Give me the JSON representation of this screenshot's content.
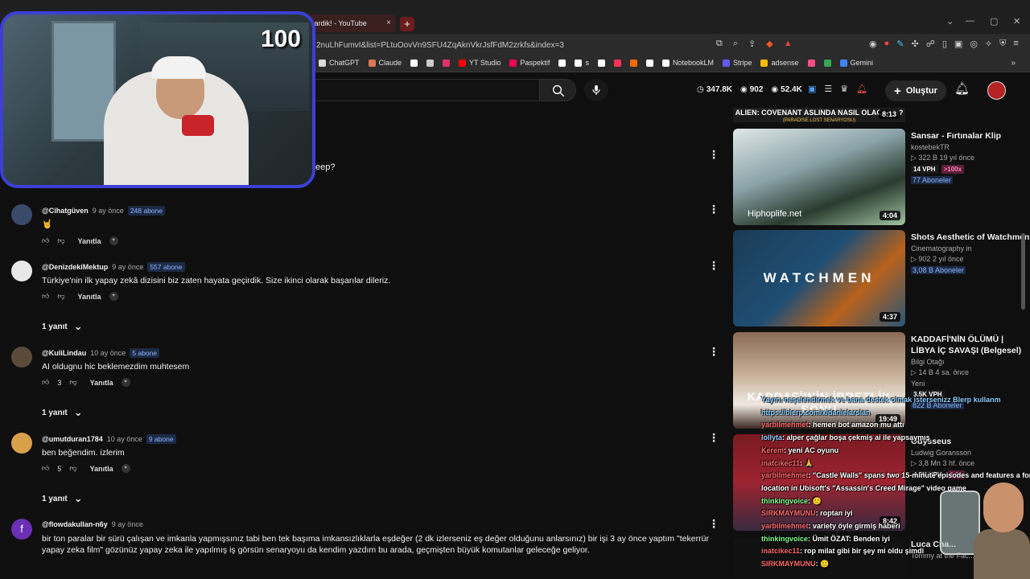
{
  "browser": {
    "tab_title": "tardik! - YouTube",
    "new_tab": "+",
    "tab_close": "×",
    "window": {
      "minimize": "—",
      "maximize": "▢",
      "close": "✕"
    },
    "url": "2nuLhFumvI&list=PLtuOovVn9SFU4ZqAknVkrJsfFdM2zrkfs&index=3",
    "bookmarks": [
      {
        "label": "ChatGPT",
        "color": "#d9d9d9"
      },
      {
        "label": "Claude",
        "color": "#d97757"
      },
      {
        "label": "",
        "color": "#ffffff"
      },
      {
        "label": "",
        "color": "#cccccc"
      },
      {
        "label": "",
        "color": "#e1306c"
      },
      {
        "label": "YT Studio",
        "color": "#ff0000"
      },
      {
        "label": "Paspektif",
        "color": "#ff0055"
      },
      {
        "label": "",
        "color": "#ffffff"
      },
      {
        "label": "s",
        "color": "#ffffff"
      },
      {
        "label": "",
        "color": "#ffffff"
      },
      {
        "label": "",
        "color": "#ff3355"
      },
      {
        "label": "",
        "color": "#ff6a00"
      },
      {
        "label": "",
        "color": "#ffffff"
      },
      {
        "label": "NotebookLM",
        "color": "#ffffff"
      },
      {
        "label": "Stripe",
        "color": "#635bff"
      },
      {
        "label": "adsense",
        "color": "#fbbc04"
      },
      {
        "label": "",
        "color": "#ff4d8a"
      },
      {
        "label": "",
        "color": "#34a853"
      },
      {
        "label": "Gemini",
        "color": "#4285f4"
      }
    ],
    "bookmarks_more": "»"
  },
  "header": {
    "stats": [
      {
        "icon": "clock-icon",
        "value": "347.8K"
      },
      {
        "icon": "eye-icon",
        "value": "902"
      },
      {
        "icon": "eye-icon",
        "value": "52.4K"
      }
    ],
    "create_label": "Oluştur"
  },
  "webcam": {
    "counter": "100"
  },
  "comments": {
    "partial_text": "eep?",
    "items": [
      {
        "user": "@Cihatgüven",
        "time": "9 ay önce",
        "subs": "248 abone",
        "text": "🤘",
        "likes": "",
        "reply": "Yanıtla",
        "avatar": "#3b4a6b"
      },
      {
        "user": "@DenizdekiMektup",
        "time": "9 ay önce",
        "subs": "557 abone",
        "text": "Türkiye'nin ilk yapay zekâ dizisini biz zaten hayata geçirdik. Size ikinci olarak başarılar dileriz.",
        "likes": "",
        "reply": "Yanıtla",
        "replies": "1 yanıt",
        "avatar": "#e8e8e8"
      },
      {
        "user": "@KuliLindau",
        "time": "10 ay önce",
        "subs": "5 abone",
        "text": "AI oldugnu hic beklemezdim muhtesem",
        "likes": "3",
        "reply": "Yanıtla",
        "replies": "1 yanıt",
        "avatar": "#5a4a3a"
      },
      {
        "user": "@umutduran1784",
        "time": "10 ay önce",
        "subs": "9 abone",
        "text": "ben beğendim. izlerim",
        "likes": "5",
        "reply": "Yanıtla",
        "replies": "1 yanıt",
        "avatar": "#d9a04a"
      },
      {
        "user": "@flowdakullan-n6y",
        "time": "9 ay önce",
        "subs": "",
        "text": "bir ton paralar bir sürü çalışan ve imkanla yapmışsınız tabi ben tek başıma imkansızlıklarla eşdeğer (2 dk izlerseniz eş değer olduğunu anlarsınız) bir işi 3 ay önce yaptım \"tekerrür yapay zeka film\" gözünüz yapay zeka ile yapılmış iş görsün senaryoyu da kendim yazdım bu arada, geçmişten büyük komutanlar geleceğe geliyor.",
        "avatar": "#6a2fb5",
        "letter": "f"
      }
    ]
  },
  "sidebar": {
    "top_banner": "ALIEN: COVENANT ASLINDA NASIL OLACAKTI?",
    "top_banner_sub": "(PARADISE LOST SENARYOSU)",
    "top_duration": "8:13",
    "videos": [
      {
        "title": "Sansar - Fırtınalar Klip",
        "channel": "kostebekTR",
        "meta": "▷ 322 B   19 yıl önce",
        "vph": "14 VPH",
        "x": ">100x",
        "subs": "77 Aboneler",
        "duration": "4:04",
        "caption": "Hiphoplife.net"
      },
      {
        "title": "Shots Aesthetic of Watchmen",
        "channel": "Cinematography in",
        "meta": "▷ 902   2 yıl önce",
        "subs": "3,08 B Aboneler",
        "duration": "4:37",
        "big": "WATCHMEN"
      },
      {
        "title": "KADDAFİ'NİN ÖLÜMÜ | LİBYA İÇ SAVAŞI (Belgesel)",
        "channel": "Bilgi Otağı",
        "meta": "▷ 14 B   4 sa. önce",
        "extra": "Yeni",
        "vph": "3.5K VPH",
        "subs": "822 B Aboneler",
        "duration": "19:49",
        "big": "KADDAFİ'NİN İBRETLİK SONU"
      },
      {
        "title": "Odysseus",
        "channel": "Ludwig Goransson",
        "meta": "▷ 3,8 Mn   3 hf. önce",
        "vph": "4.9K VPH",
        "x": "6.9x",
        "duration": "8:42"
      },
      {
        "title": "Luca Cha...",
        "channel": "Tommy at the Fac..."
      }
    ]
  },
  "chat": [
    {
      "name": "",
      "text": "Yayını neşelendirmek ve bana destek olmak istersenizz Blerp kullanm",
      "cls": "blue"
    },
    {
      "name": "",
      "text": "https://blerp.com/x/danielarslan",
      "cls": "blue"
    },
    {
      "name": "yarbilmehmet",
      "text": ": hemen bot amazon mu attı",
      "cls": ""
    },
    {
      "name": "lollyta",
      "text": ": alper çağlar boşa çekmiş ai ile yapsaymış",
      "cls": "blue"
    },
    {
      "name": "Kerem",
      "text": ": yeni AC oyunu",
      "cls": ""
    },
    {
      "name": "inatcikec11",
      "text": ": 🙏",
      "cls": ""
    },
    {
      "name": "yarbilmehmet",
      "text": ": \"Castle Walls\" spans two 15-minute episodes and features a fort",
      "cls": ""
    },
    {
      "name": "",
      "text": "location in Ubisoft's \"Assassin's Creed Mirage\" video game",
      "cls": ""
    },
    {
      "name": "thinkingvoice",
      "text": ": 🙂",
      "cls": "green"
    },
    {
      "name": "SIRKMAYMUNU",
      "text": ": roptan iyi",
      "cls": ""
    },
    {
      "name": "yarbilmehmet",
      "text": ": variety öyle girmiş haberi",
      "cls": ""
    },
    {
      "name": "thinkingvoice",
      "text": ": Ümit ÖZAT: Benden iyi",
      "cls": "green"
    },
    {
      "name": "inatcikec11",
      "text": ": rop milat gibi bir şey mi oldu şimdi",
      "cls": ""
    },
    {
      "name": "SIRKMAYMUNU",
      "text": ": 🙂",
      "cls": ""
    }
  ]
}
